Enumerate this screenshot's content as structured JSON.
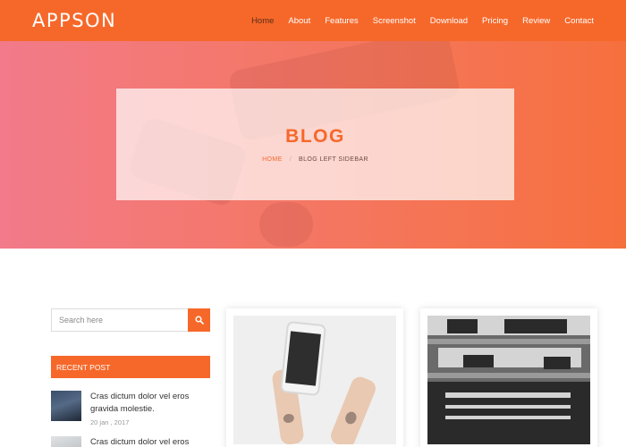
{
  "brand": {
    "logo": "APPSON",
    "accent_color": "#f6682a"
  },
  "nav": {
    "items": [
      {
        "label": "Home",
        "active": true
      },
      {
        "label": "About"
      },
      {
        "label": "Features"
      },
      {
        "label": "Screenshot"
      },
      {
        "label": "Download"
      },
      {
        "label": "Pricing"
      },
      {
        "label": "Review"
      },
      {
        "label": "Contact"
      }
    ]
  },
  "hero": {
    "title": "BLOG",
    "breadcrumb": {
      "home": "HOME",
      "separator": "/",
      "current": "BLOG LEFT SIDEBAR"
    }
  },
  "sidebar": {
    "search": {
      "placeholder": "Search here",
      "icon": "search-icon"
    },
    "recent": {
      "title": "RECENT POST",
      "posts": [
        {
          "title": "Cras dictum dolor vel eros gravida molestie.",
          "date": "20 jan , 2017"
        },
        {
          "title": "Cras dictum dolor vel eros",
          "date": ""
        }
      ]
    }
  },
  "posts": [
    {
      "image": "hands-holding-smartphone"
    },
    {
      "image": "black-and-white-window-hands"
    }
  ]
}
